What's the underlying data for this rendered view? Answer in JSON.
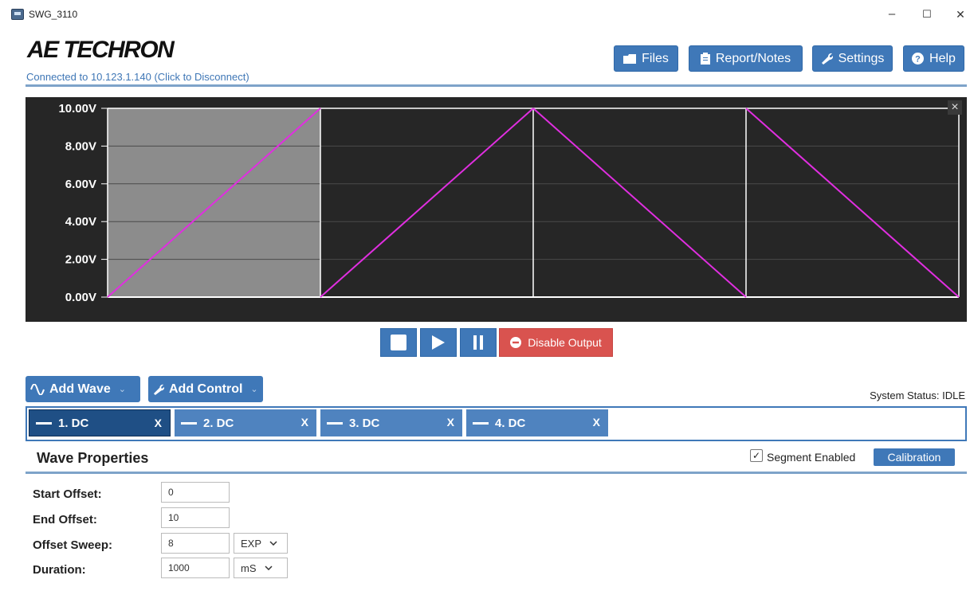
{
  "window": {
    "title": "SWG_3110",
    "minimize": "–",
    "maximize": "☐",
    "close": "✕"
  },
  "header": {
    "brand": "AE TECHRON",
    "connection": "Connected to 10.123.1.140 (Click to Disconnect)",
    "buttons": {
      "files": "Files",
      "report_notes": "Report/Notes",
      "settings": "Settings",
      "help": "Help"
    }
  },
  "plot": {
    "close": "×",
    "chart_data": {
      "type": "line",
      "y_tick_labels": [
        "10.00V",
        "8.00V",
        "6.00V",
        "4.00V",
        "2.00V",
        "0.00V"
      ],
      "ylim": [
        0,
        10
      ],
      "grid": true,
      "segments": [
        {
          "index": 1,
          "start": 0,
          "end": 10,
          "selected": true
        },
        {
          "index": 2,
          "start": 0,
          "end": 10
        },
        {
          "index": 3,
          "start": 10,
          "end": 0
        },
        {
          "index": 4,
          "start": 10,
          "end": 0
        }
      ],
      "colors": {
        "trace": "#e02ee0",
        "background": "#262626",
        "selected_fill": "#8c8c8c",
        "divider": "#ffffff"
      }
    }
  },
  "transport": {
    "disable_output": "Disable Output"
  },
  "toolbar": {
    "add_wave": "Add Wave",
    "add_control": "Add Control"
  },
  "status": {
    "system_status": "System Status: IDLE"
  },
  "tabs": [
    {
      "label": "1. DC",
      "close": "X",
      "active": true
    },
    {
      "label": "2. DC",
      "close": "X"
    },
    {
      "label": "3. DC",
      "close": "X"
    },
    {
      "label": "4. DC",
      "close": "X"
    }
  ],
  "wave_properties": {
    "title": "Wave Properties",
    "segment_enabled_label": "Segment Enabled",
    "segment_enabled": true,
    "check_mark": "✓",
    "calibration": "Calibration",
    "fields": {
      "start_offset": {
        "label": "Start Offset:",
        "value": "0"
      },
      "end_offset": {
        "label": "End Offset:",
        "value": "10"
      },
      "offset_sweep": {
        "label": "Offset Sweep:",
        "value": "8",
        "mode": "EXP"
      },
      "duration": {
        "label": "Duration:",
        "value": "1000",
        "unit": "mS"
      }
    }
  }
}
